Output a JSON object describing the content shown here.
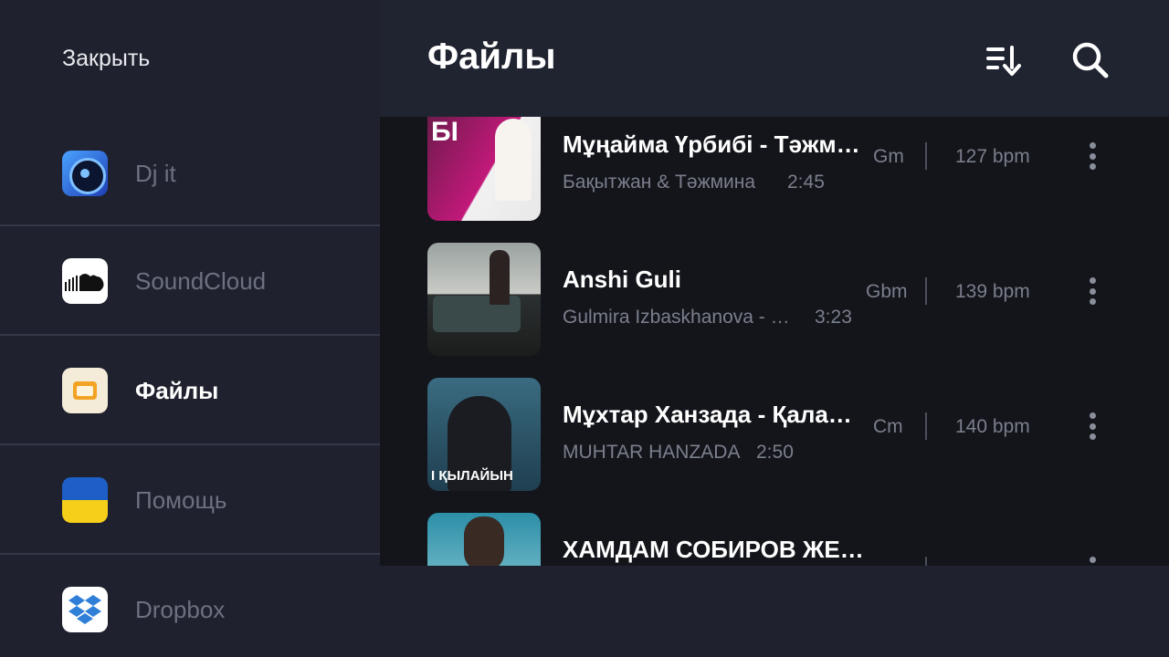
{
  "sidebar": {
    "close_label": "Закрыть",
    "items": [
      {
        "label": "Dj it",
        "icon": "djit-app-icon",
        "active": false
      },
      {
        "label": "SoundCloud",
        "icon": "soundcloud-icon",
        "active": false
      },
      {
        "label": "Файлы",
        "icon": "files-folder-icon",
        "active": true
      },
      {
        "label": "Помощь",
        "icon": "ukraine-flag-icon",
        "active": false
      },
      {
        "label": "Dropbox",
        "icon": "dropbox-icon",
        "active": false
      }
    ]
  },
  "header": {
    "title": "Файлы",
    "sort_icon": "sort-icon",
    "search_icon": "search-icon"
  },
  "tracks": [
    {
      "title": "Мұңайма Үрбибі - Тәжм…",
      "artist": "Бақытжан & Тәжмина",
      "duration": "2:45",
      "key": "Gm",
      "bpm": "127 bpm",
      "cover_text": "БІ"
    },
    {
      "title": "Anshi Guli",
      "artist": "Gulmira Izbaskhanova - …",
      "duration": "3:23",
      "key": "Gbm",
      "bpm": "139 bpm"
    },
    {
      "title": "Мұхтар Ханзада -  Қала…",
      "artist": "MUHTAR HANZADA",
      "duration": "2:50",
      "key": "Cm",
      "bpm": "140 bpm",
      "cover_text": "І ҚЫЛАЙЫН"
    },
    {
      "title": "ХАМДАМ СОБИРОВ ЖЕ…",
      "artist": "",
      "duration": "",
      "key": "",
      "bpm": ""
    }
  ],
  "colors": {
    "background": "#1f222e",
    "list_background": "#13151b",
    "text_primary": "#ffffff",
    "text_secondary": "#7b7f8c"
  }
}
